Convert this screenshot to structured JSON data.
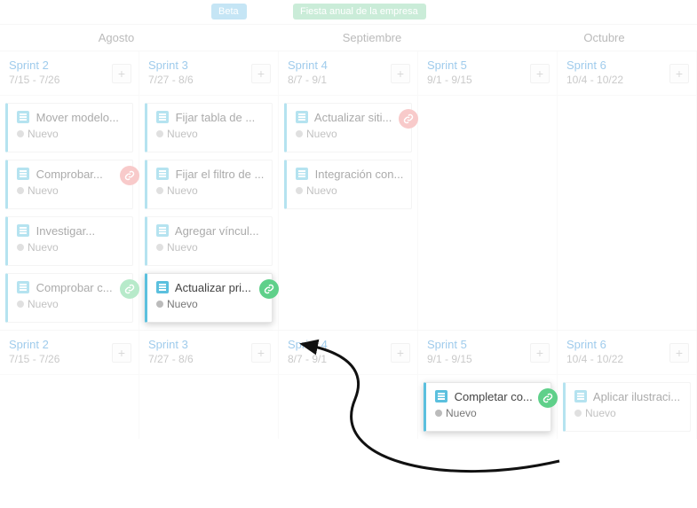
{
  "milestones": {
    "beta": "Beta",
    "fiesta": "Fiesta anual de la empresa"
  },
  "months": {
    "aug": "Agosto",
    "sep": "Septiembre",
    "oct": "Octubre"
  },
  "status_new": "Nuevo",
  "sprints_top": [
    {
      "name": "Sprint 2",
      "dates": "7/15 - 7/26",
      "cards": [
        {
          "title": "Mover modelo...",
          "dep": null
        },
        {
          "title": "Comprobar...",
          "dep": "red"
        },
        {
          "title": "Investigar...",
          "dep": null
        },
        {
          "title": "Comprobar c...",
          "dep": "green"
        }
      ]
    },
    {
      "name": "Sprint 3",
      "dates": "7/27 - 8/6",
      "cards": [
        {
          "title": "Fijar tabla de ...",
          "dep": null
        },
        {
          "title": "Fijar el filtro de ...",
          "dep": null
        },
        {
          "title": "Agregar víncul...",
          "dep": null
        },
        {
          "title": "Actualizar pri...",
          "dep": "green",
          "highlight": true
        }
      ]
    },
    {
      "name": "Sprint 4",
      "dates": "8/7 - 9/1",
      "cards": [
        {
          "title": "Actualizar siti...",
          "dep": "red"
        },
        {
          "title": "Integración con...",
          "dep": null
        }
      ]
    },
    {
      "name": "Sprint 5",
      "dates": "9/1 - 9/15",
      "cards": []
    },
    {
      "name": "Sprint 6",
      "dates": "10/4 - 10/22",
      "cards": []
    }
  ],
  "sprints_bottom": [
    {
      "name": "Sprint 2",
      "dates": "7/15 - 7/26",
      "cards": []
    },
    {
      "name": "Sprint 3",
      "dates": "7/27 - 8/6",
      "cards": []
    },
    {
      "name": "Sprint 4",
      "dates": "8/7 - 9/1",
      "cards": []
    },
    {
      "name": "Sprint 5",
      "dates": "9/1 - 9/15",
      "cards": [
        {
          "title": "Completar co...",
          "dep": "green",
          "highlight": true
        }
      ]
    },
    {
      "name": "Sprint 6",
      "dates": "10/4 - 10/22",
      "cards": [
        {
          "title": "Aplicar ilustraci...",
          "dep": null
        }
      ]
    }
  ]
}
